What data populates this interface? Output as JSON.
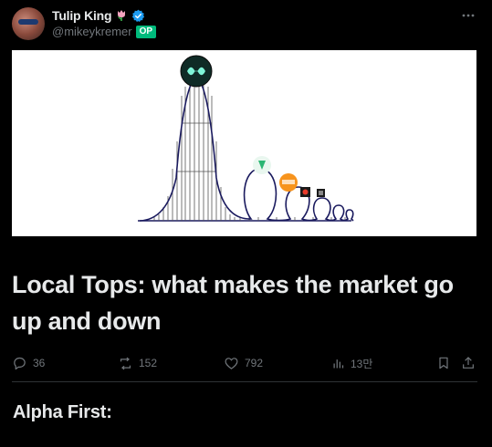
{
  "post": {
    "author": {
      "display_name": "Tulip King",
      "handle": "@mikeykremer",
      "badge": "OP",
      "verified": true,
      "emoji_icon": "tulip-icon"
    },
    "headline": "Local Tops: what makes the market go up and down",
    "metrics": {
      "replies": "36",
      "reposts": "152",
      "likes": "792",
      "views": "13만"
    },
    "section_title": "Alpha First:"
  },
  "colors": {
    "background": "#000000",
    "text_primary": "#e7e9ea",
    "text_secondary": "#71767b",
    "verified": "#1d9bf0",
    "badge": "#00ba7c",
    "coaster_track": "#1a1a5e"
  },
  "icons": [
    "more-icon",
    "reply-icon",
    "repost-icon",
    "like-icon",
    "views-icon",
    "bookmark-icon",
    "share-icon",
    "verified-icon",
    "tulip-icon"
  ]
}
